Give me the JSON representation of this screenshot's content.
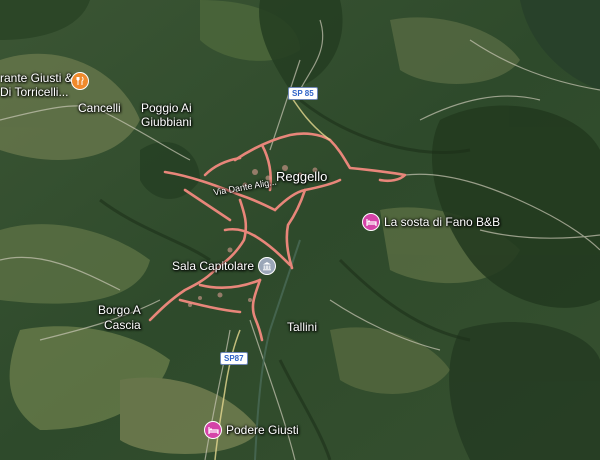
{
  "map": {
    "view": "satellite",
    "colors": {
      "urban_road": "#e8867a",
      "restaurant_pin": "#f08a2c",
      "hotel_pin": "#d543a8",
      "landmark_pin": "#9aa6b8",
      "road_shield_text": "#2f63c7"
    },
    "places": {
      "reggello": "Reggello",
      "cancelli": "Cancelli",
      "poggio_line1": "Poggio Ai",
      "poggio_line2": "Giubbiani",
      "borgo_line1": "Borgo A",
      "borgo_line2": "Cascia",
      "tallini": "Tallini",
      "street": "Via Dante Alig..."
    },
    "pois": {
      "restaurant_line1": "rante Giusti &",
      "restaurant_line2": "Di Torricelli...",
      "sosta": "La sosta di Fano B&B",
      "sala": "Sala Capitolare",
      "podere": "Podere Giusti"
    },
    "road_shields": {
      "sp85": "SP 85",
      "sp87": "SP87"
    },
    "icons": {
      "restaurant": "fork-knife-icon",
      "hotel": "bed-icon",
      "landmark": "building-columns-icon"
    }
  }
}
